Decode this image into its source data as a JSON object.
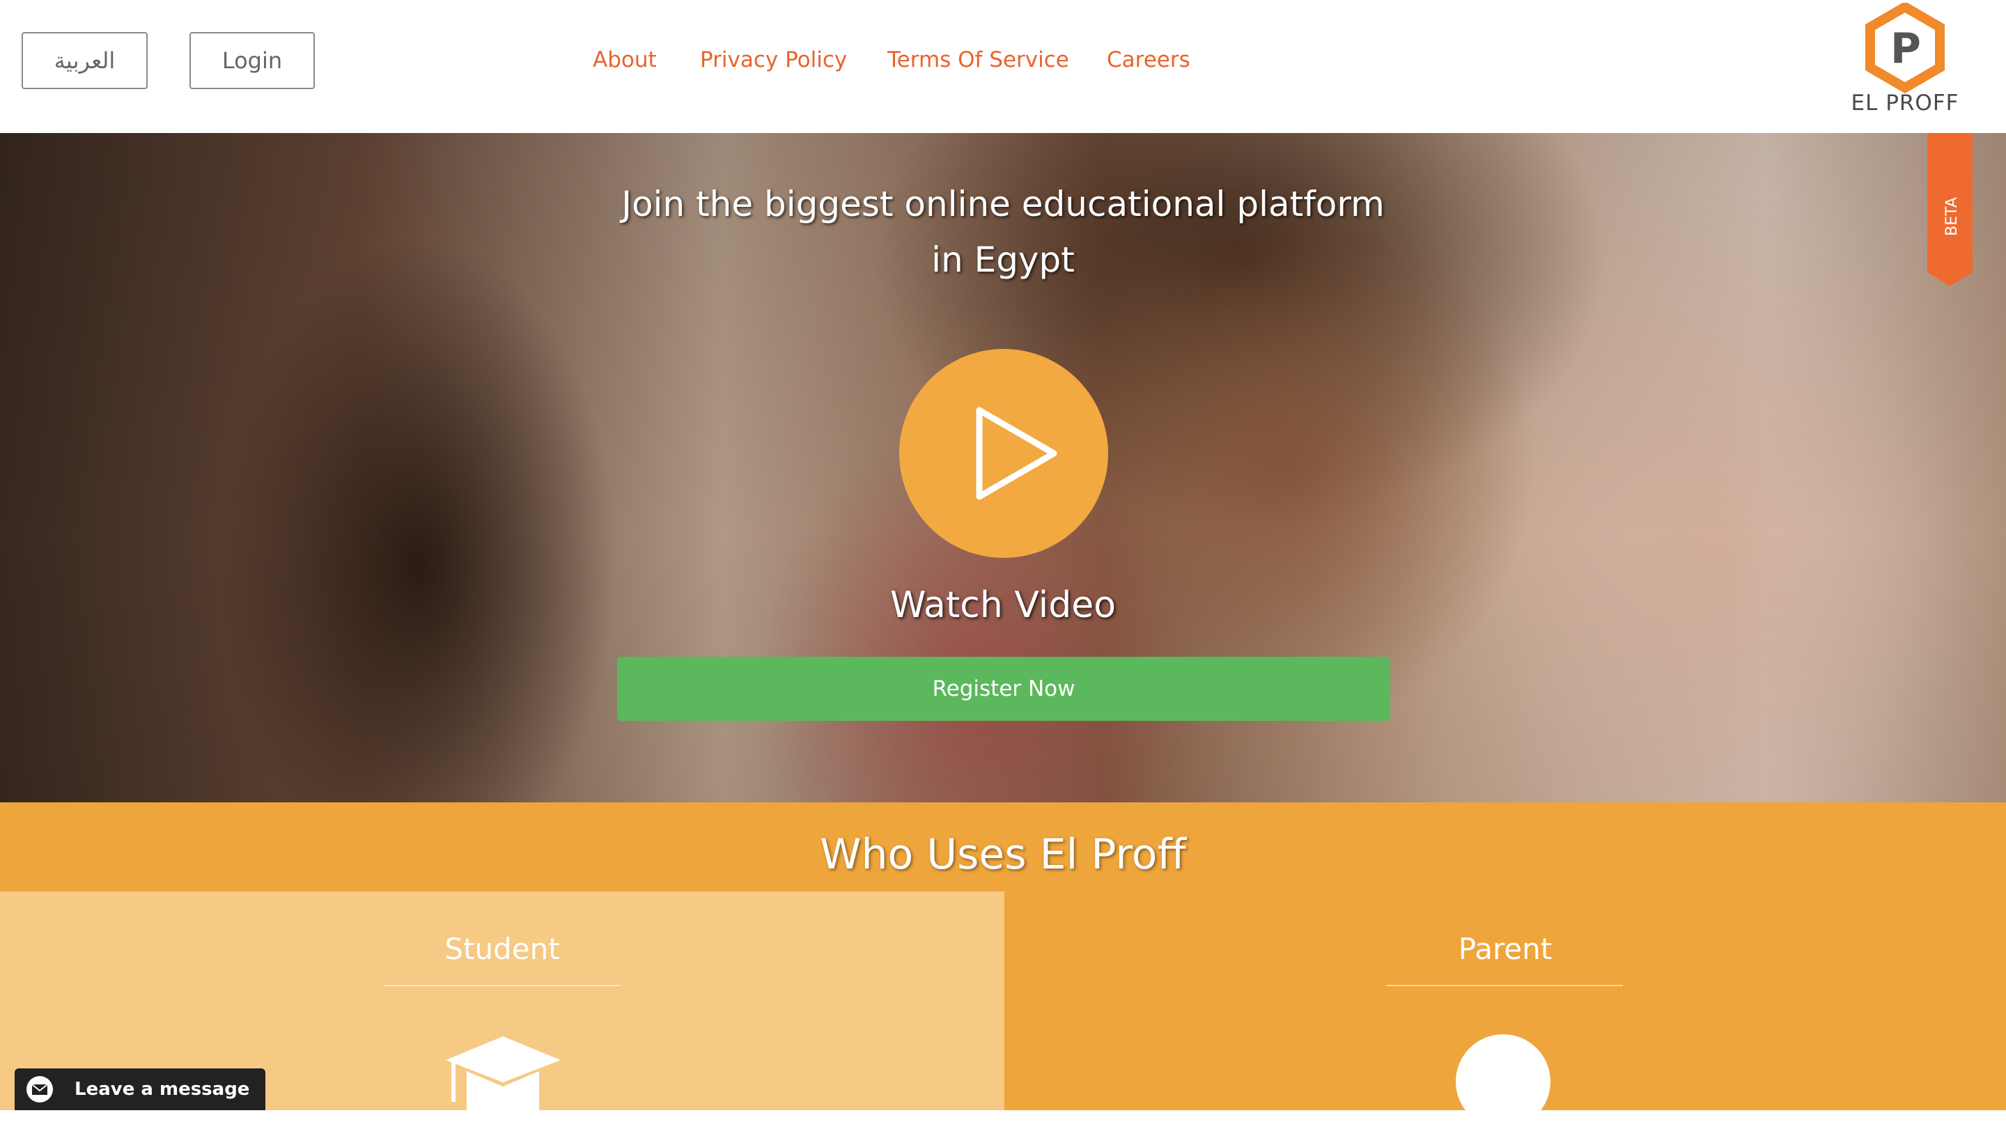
{
  "header": {
    "language_button": "العربية",
    "login_button": "Login",
    "nav": [
      "About",
      "Privacy Policy",
      "Terms Of Service",
      "Careers"
    ],
    "logo_text": "EL PROFF",
    "logo_letter": "P"
  },
  "hero": {
    "title_line1": "Join the biggest online educational platform",
    "title_line2": "in Egypt",
    "watch_label": "Watch Video",
    "register_label": "Register Now",
    "beta_label": "BETA"
  },
  "who": {
    "title": "Who Uses El Proff",
    "panels": [
      {
        "label": "Student"
      },
      {
        "label": "Parent"
      }
    ]
  },
  "chat": {
    "label": "Leave a message"
  },
  "colors": {
    "accent_orange": "#e8642c",
    "play_orange": "#f2a941",
    "register_green": "#5cb85c",
    "section_orange": "#eea53b",
    "student_panel": "#f6c985"
  },
  "icons": [
    "play-icon",
    "graduation-cap-icon",
    "parent-icon",
    "envelope-icon",
    "logo-hexagon-icon"
  ]
}
